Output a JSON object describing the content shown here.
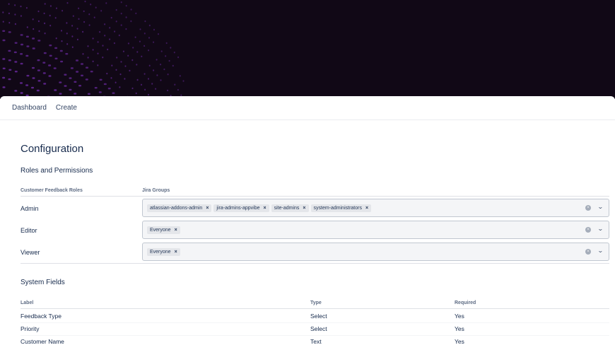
{
  "nav": {
    "items": [
      "Dashboard",
      "Create"
    ]
  },
  "page_title": "Configuration",
  "roles": {
    "title": "Roles and Permissions",
    "headers": [
      "Customer Feedback Roles",
      "Jira Groups"
    ],
    "rows": [
      {
        "role": "Admin",
        "groups": [
          "atlassian-addons-admin",
          "jira-admins-appvibe",
          "site-admins",
          "system-administrators"
        ]
      },
      {
        "role": "Editor",
        "groups": [
          "Everyone"
        ]
      },
      {
        "role": "Viewer",
        "groups": [
          "Everyone"
        ]
      }
    ]
  },
  "system_fields": {
    "title": "System Fields",
    "headers": [
      "Label",
      "Type",
      "Required"
    ],
    "rows": [
      [
        "Feedback Type",
        "Select",
        "Yes"
      ],
      [
        "Priority",
        "Select",
        "Yes"
      ],
      [
        "Customer Name",
        "Text",
        "Yes"
      ]
    ]
  },
  "icons": {
    "remove": "×",
    "clear": "×",
    "chevron": "⌄"
  },
  "colors": {
    "banner": "#110816",
    "dots": "#6a2aa0"
  }
}
